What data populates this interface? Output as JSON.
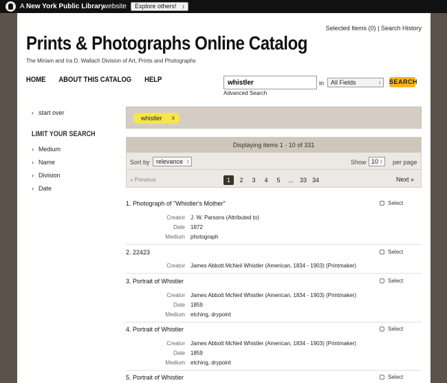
{
  "topbar": {
    "a": "A",
    "nypl": "New York Public Library",
    "website": "website",
    "explore": "Explore others!"
  },
  "header": {
    "selected_items": "Selected Items (0)",
    "separator": "|",
    "search_history": "Search History",
    "title": "Prints & Photographs Online Catalog",
    "subtitle": "The Miriam and Ira D. Wallach Division of Art, Prints and Photographs"
  },
  "nav": {
    "home": "HOME",
    "about": "ABOUT THIS CATALOG",
    "help": "HELP"
  },
  "search": {
    "query": "whistler",
    "in_label": "in",
    "field": "All Fields",
    "button": "SEARCH",
    "advanced": "Advanced Search"
  },
  "sidebar": {
    "start_over": "start over",
    "limit_title": "LIMIT YOUR SEARCH",
    "facets": [
      "Medium",
      "Name",
      "Division",
      "Date"
    ]
  },
  "filter": {
    "chip": "whistler",
    "remove": "x"
  },
  "results": {
    "displaying": "Displaying items 1 - 10 of 331",
    "sort_label": "Sort by",
    "sort_value": "relevance",
    "show_label": "Show",
    "per_page": "10",
    "per_page_label": "per page",
    "previous": "« Previous",
    "pages": [
      "1",
      "2",
      "3",
      "4",
      "5",
      "...",
      "33",
      "34"
    ],
    "next": "Next »",
    "select_label": "Select"
  },
  "items": [
    {
      "title": "1. Photograph of \"Whistler's Mother\"",
      "meta": [
        {
          "k": "Creator",
          "v": "J. W. Parsons (Attributed to)"
        },
        {
          "k": "Date",
          "v": "1872"
        },
        {
          "k": "Medium",
          "v": "photograph"
        }
      ]
    },
    {
      "title": "2. 22423",
      "meta": [
        {
          "k": "Creator",
          "v": "James Abbott McNeil Whistler (American, 1834 - 1903) (Printmaker)"
        }
      ]
    },
    {
      "title": "3. Portrait of Whistler",
      "meta": [
        {
          "k": "Creator",
          "v": "James Abbott McNeil Whistler (American, 1834 - 1903) (Printmaker)"
        },
        {
          "k": "Date",
          "v": "1859"
        },
        {
          "k": "Medium",
          "v": "etching, drypoint"
        }
      ]
    },
    {
      "title": "4. Portrait of Whistler",
      "meta": [
        {
          "k": "Creator",
          "v": "James Abbott McNeil Whistler (American, 1834 - 1903) (Printmaker)"
        },
        {
          "k": "Date",
          "v": "1859"
        },
        {
          "k": "Medium",
          "v": "etching, drypoint"
        }
      ]
    },
    {
      "title": "5. Portrait of Whistler",
      "meta": []
    }
  ]
}
